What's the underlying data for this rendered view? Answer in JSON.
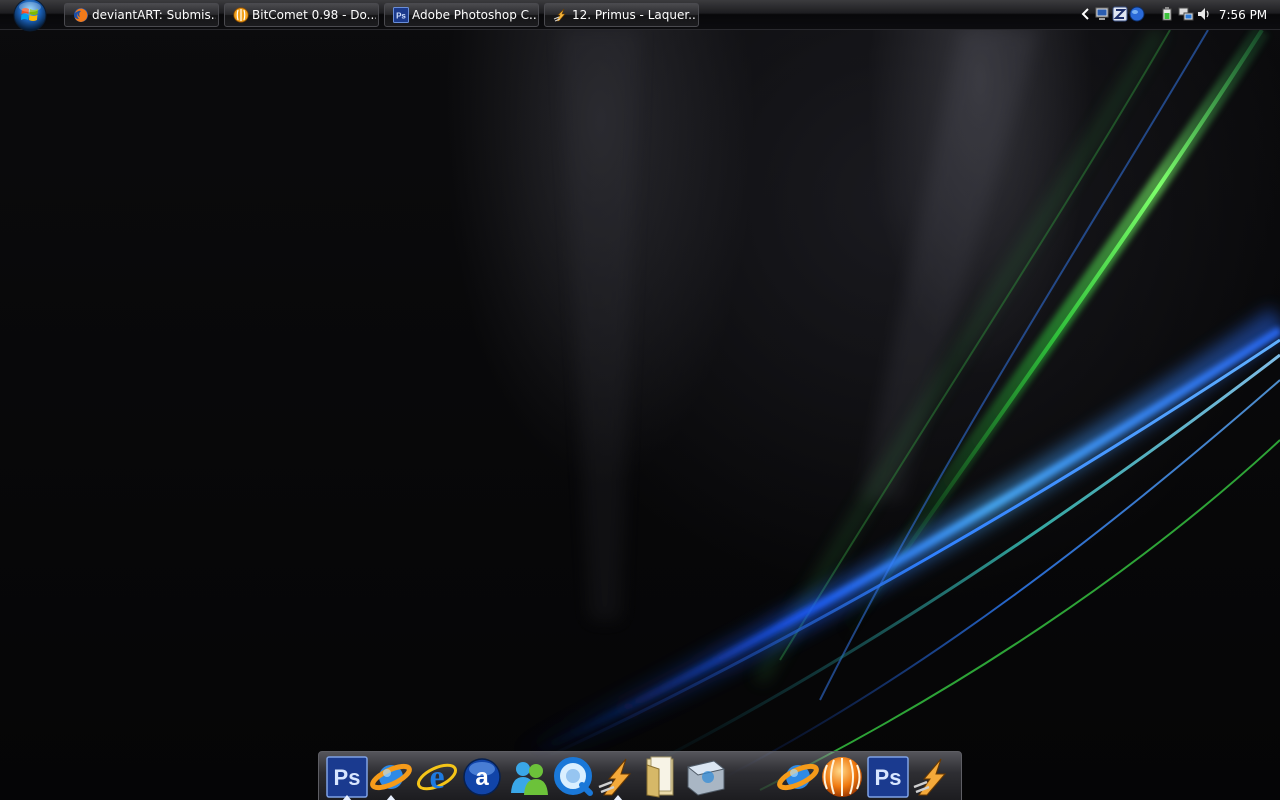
{
  "taskbar": {
    "start_button": {
      "icon": "windows-orb-icon"
    },
    "tasks": [
      {
        "label": "deviantART: Submis...",
        "icon": "firefox-icon"
      },
      {
        "label": "BitComet 0.98 - Do...",
        "icon": "bitcomet-icon"
      },
      {
        "label": "Adobe Photoshop C...",
        "icon": "photoshop-icon"
      },
      {
        "label": "12. Primus - Laquer...",
        "icon": "winamp-icon"
      }
    ],
    "tray": {
      "expand_icon": "chevron-left-icon",
      "icons": [
        "network-monitor-icon",
        "zonealarm-icon",
        "globe-icon",
        "power-icon",
        "network-icon",
        "volume-icon"
      ],
      "clock": "7:56 PM"
    }
  },
  "dock": {
    "items": [
      {
        "icon": "photoshop-icon",
        "running": true
      },
      {
        "icon": "orbit-downloader-icon",
        "running": true
      },
      {
        "icon": "internet-explorer-icon",
        "running": false
      },
      {
        "icon": "aim-icon",
        "running": false
      },
      {
        "icon": "windows-live-messenger-icon",
        "running": false
      },
      {
        "icon": "quicktime-icon",
        "running": false
      },
      {
        "icon": "winamp-icon",
        "running": true
      },
      {
        "icon": "folder-icon",
        "running": false
      },
      {
        "icon": "scanner-icon",
        "running": false
      },
      {
        "icon": "orbit-downloader-icon",
        "running": false
      },
      {
        "icon": "bitcomet-icon",
        "running": false
      },
      {
        "icon": "photoshop-icon",
        "running": false
      },
      {
        "icon": "winamp-icon",
        "running": false
      }
    ]
  },
  "colors": {
    "wallpaper_green": "#46e04a",
    "wallpaper_blue": "#2a7dff",
    "taskbar_text": "#ffffff"
  }
}
